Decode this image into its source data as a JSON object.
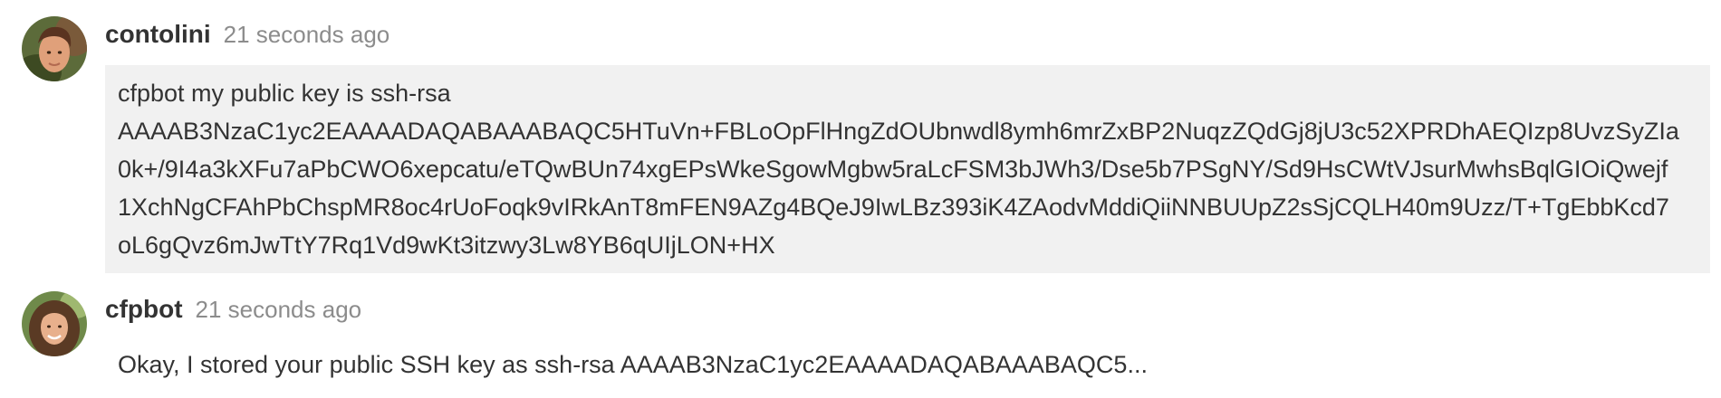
{
  "messages": [
    {
      "username": "contolini",
      "timestamp": "21 seconds ago",
      "avatar_icon": "user-avatar-photo",
      "lines": [
        "cfpbot my public key is ssh-rsa",
        "AAAAB3NzaC1yc2EAAAADAQABAAABAQC5HTuVn+FBLoOpFlHngZdOUbnwdl8ymh6mrZxBP2NuqzZQdGj8jU3c52XPRDhAEQIzp8UvzSyZIa",
        "0k+/9I4a3kXFu7aPbCWO6xepcatu/eTQwBUn74xgEPsWkeSgowMgbw5raLcFSM3bJWh3/Dse5b7PSgNY/Sd9HsCWtVJsurMwhsBqlGIOiQwejf",
        "1XchNgCFAhPbChspMR8oc4rUoFoqk9vIRkAnT8mFEN9AZg4BQeJ9IwLBz393iK4ZAodvMddiQiiNNBUUpZ2sSjCQLH40m9Uzz/T+TgEbbKcd7",
        "oL6gQvz6mJwTtY7Rq1Vd9wKt3itzwy3Lw8YB6qUIjLON+HX"
      ]
    },
    {
      "username": "cfpbot",
      "timestamp": "21 seconds ago",
      "avatar_icon": "bot-avatar-photo",
      "text": "Okay, I stored your public SSH key as ssh-rsa AAAAB3NzaC1yc2EAAAADAQABAAABAQC5..."
    }
  ],
  "colors": {
    "bubble_background": "#f1f1f1",
    "username": "#333333",
    "timestamp": "#8c8c8c"
  }
}
